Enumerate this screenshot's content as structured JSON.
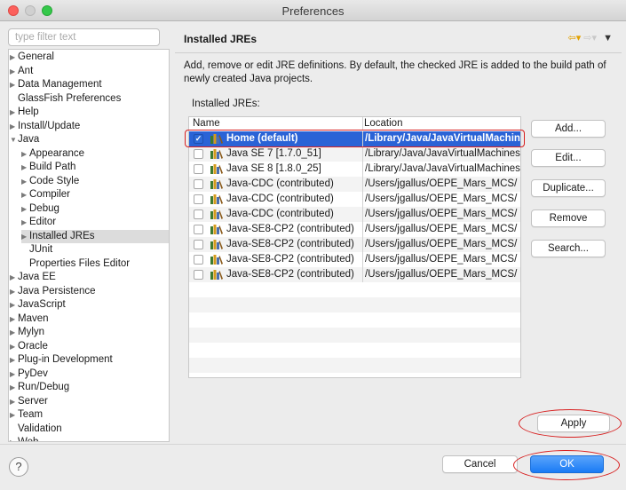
{
  "window": {
    "title": "Preferences"
  },
  "filter": {
    "placeholder": "type filter text"
  },
  "tree": [
    {
      "label": "General",
      "arrow": "▶",
      "indent": 0
    },
    {
      "label": "Ant",
      "arrow": "▶",
      "indent": 0
    },
    {
      "label": "Data Management",
      "arrow": "▶",
      "indent": 0
    },
    {
      "label": "GlassFish Preferences",
      "arrow": "",
      "indent": 0
    },
    {
      "label": "Help",
      "arrow": "▶",
      "indent": 0
    },
    {
      "label": "Install/Update",
      "arrow": "▶",
      "indent": 0
    },
    {
      "label": "Java",
      "arrow": "▼",
      "indent": 0
    },
    {
      "label": "Appearance",
      "arrow": "▶",
      "indent": 1
    },
    {
      "label": "Build Path",
      "arrow": "▶",
      "indent": 1
    },
    {
      "label": "Code Style",
      "arrow": "▶",
      "indent": 1
    },
    {
      "label": "Compiler",
      "arrow": "▶",
      "indent": 1
    },
    {
      "label": "Debug",
      "arrow": "▶",
      "indent": 1
    },
    {
      "label": "Editor",
      "arrow": "▶",
      "indent": 1
    },
    {
      "label": "Installed JREs",
      "arrow": "▶",
      "indent": 1,
      "selected": true
    },
    {
      "label": "JUnit",
      "arrow": "",
      "indent": 1
    },
    {
      "label": "Properties Files Editor",
      "arrow": "",
      "indent": 1
    },
    {
      "label": "Java EE",
      "arrow": "▶",
      "indent": 0
    },
    {
      "label": "Java Persistence",
      "arrow": "▶",
      "indent": 0
    },
    {
      "label": "JavaScript",
      "arrow": "▶",
      "indent": 0
    },
    {
      "label": "Maven",
      "arrow": "▶",
      "indent": 0
    },
    {
      "label": "Mylyn",
      "arrow": "▶",
      "indent": 0
    },
    {
      "label": "Oracle",
      "arrow": "▶",
      "indent": 0
    },
    {
      "label": "Plug-in Development",
      "arrow": "▶",
      "indent": 0
    },
    {
      "label": "PyDev",
      "arrow": "▶",
      "indent": 0
    },
    {
      "label": "Run/Debug",
      "arrow": "▶",
      "indent": 0
    },
    {
      "label": "Server",
      "arrow": "▶",
      "indent": 0
    },
    {
      "label": "Team",
      "arrow": "▶",
      "indent": 0
    },
    {
      "label": "Validation",
      "arrow": "",
      "indent": 0
    },
    {
      "label": "Web",
      "arrow": "▶",
      "indent": 0
    }
  ],
  "header": {
    "title": "Installed JREs",
    "nav_back": "⇦▾",
    "nav_fwd": "⇨▾",
    "menu": "▼"
  },
  "description": "Add, remove or edit JRE definitions. By default, the checked JRE is added to the build path of newly created Java projects.",
  "section_label": "Installed JREs:",
  "table": {
    "columns": [
      "Name",
      "Location"
    ],
    "rows": [
      {
        "name": "Home (default)",
        "location": "/Library/Java/JavaVirtualMachines",
        "checked": true,
        "selected": true
      },
      {
        "name": "Java SE 7 [1.7.0_51]",
        "location": "/Library/Java/JavaVirtualMachines",
        "checked": false
      },
      {
        "name": "Java SE 8 [1.8.0_25]",
        "location": "/Library/Java/JavaVirtualMachines",
        "checked": false
      },
      {
        "name": "Java-CDC (contributed)",
        "location": "/Users/jgallus/OEPE_Mars_MCS/",
        "checked": false
      },
      {
        "name": "Java-CDC (contributed)",
        "location": "/Users/jgallus/OEPE_Mars_MCS/",
        "checked": false
      },
      {
        "name": "Java-CDC (contributed)",
        "location": "/Users/jgallus/OEPE_Mars_MCS/",
        "checked": false
      },
      {
        "name": "Java-SE8-CP2 (contributed)",
        "location": "/Users/jgallus/OEPE_Mars_MCS/",
        "checked": false
      },
      {
        "name": "Java-SE8-CP2 (contributed)",
        "location": "/Users/jgallus/OEPE_Mars_MCS/",
        "checked": false
      },
      {
        "name": "Java-SE8-CP2 (contributed)",
        "location": "/Users/jgallus/OEPE_Mars_MCS/",
        "checked": false
      },
      {
        "name": "Java-SE8-CP2 (contributed)",
        "location": "/Users/jgallus/OEPE_Mars_MCS/",
        "checked": false
      }
    ]
  },
  "buttons": {
    "add": "Add...",
    "edit": "Edit...",
    "duplicate": "Duplicate...",
    "remove": "Remove",
    "search": "Search...",
    "apply": "Apply",
    "cancel": "Cancel",
    "ok": "OK",
    "help": "?"
  },
  "colors": {
    "selection": "#2a63d6",
    "annotation": "#d71f1f",
    "primary": "#1a7bf5"
  }
}
